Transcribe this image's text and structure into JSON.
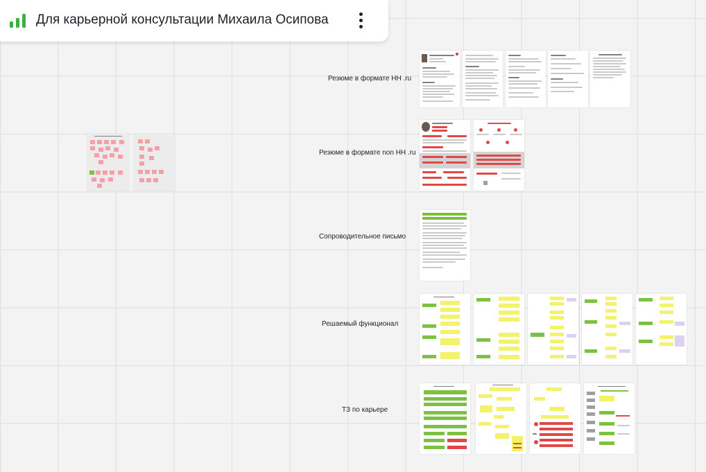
{
  "board": {
    "title": "Для карьерной консультации Михаила Осипова",
    "icon": "board-bar-chart-icon",
    "menu_icon": "more-vertical-icon"
  },
  "sections": [
    {
      "id": "hh",
      "label": "Резюме в формате НН .ru"
    },
    {
      "id": "nonhh",
      "label": "Резюме в формате non НН .ru"
    },
    {
      "id": "cover",
      "label": "Сопроводительное письмо"
    },
    {
      "id": "func",
      "label": "Решаемый функционал"
    },
    {
      "id": "tz",
      "label": "ТЗ по карьере"
    }
  ],
  "colors": {
    "canvas": "#f3f3f3",
    "grid": "#dedede",
    "sticky_pink": "#f4a0a8",
    "sticky_green": "#7cc142",
    "accent_yellow": "#f4f26a",
    "accent_red": "#e04848",
    "accent_lavender": "#d9d2f0",
    "brand_green": "#3cb043"
  }
}
